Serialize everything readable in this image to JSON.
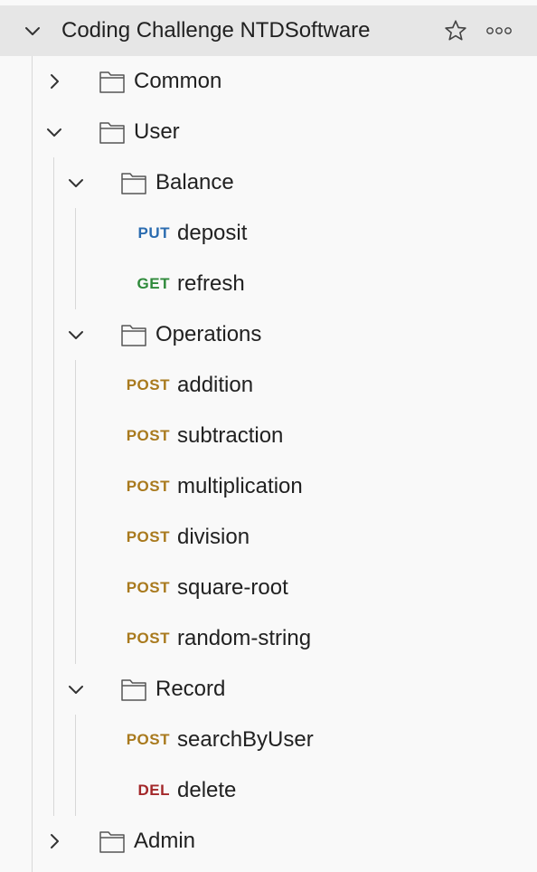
{
  "collection": {
    "name": "Coding Challenge NTDSoftware",
    "star_icon": "star-icon",
    "more_icon": "more-options-icon"
  },
  "folders": {
    "common": "Common",
    "user": "User",
    "balance": "Balance",
    "operations": "Operations",
    "record": "Record",
    "admin": "Admin"
  },
  "requests": {
    "deposit": {
      "method": "PUT",
      "name": "deposit"
    },
    "refresh": {
      "method": "GET",
      "name": "refresh"
    },
    "addition": {
      "method": "POST",
      "name": "addition"
    },
    "subtraction": {
      "method": "POST",
      "name": "subtraction"
    },
    "multiplication": {
      "method": "POST",
      "name": "multiplication"
    },
    "division": {
      "method": "POST",
      "name": "division"
    },
    "square_root": {
      "method": "POST",
      "name": "square-root"
    },
    "random_string": {
      "method": "POST",
      "name": "random-string"
    },
    "search_by_user": {
      "method": "POST",
      "name": "searchByUser"
    },
    "delete": {
      "method": "DEL",
      "name": "delete"
    }
  },
  "colors": {
    "put": "#2b6cb0",
    "get": "#2f8a3b",
    "post": "#a97a1e",
    "del": "#a3282a",
    "header_bg": "#e6e6e6",
    "panel_bg": "#f9f9f9"
  }
}
